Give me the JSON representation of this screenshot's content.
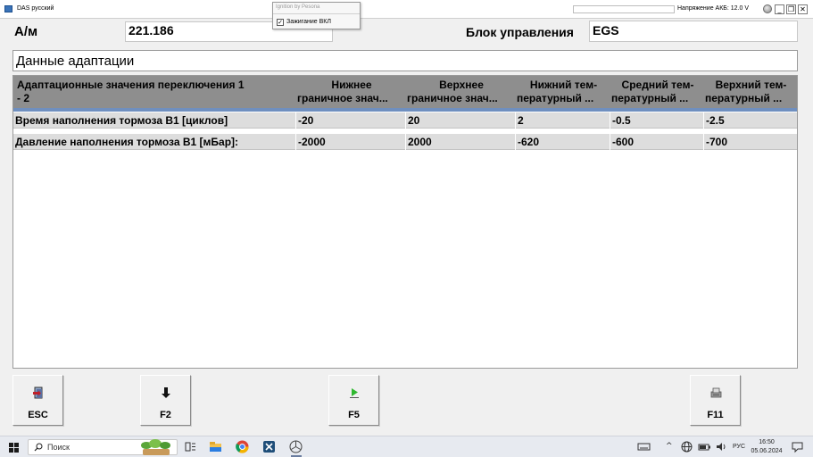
{
  "window": {
    "title": "DAS русский",
    "voltage_label": "Напряжение АКБ: 12.0 V",
    "buttons": {
      "minimize": "_",
      "restore": "❐",
      "close": "✕"
    }
  },
  "popup": {
    "title": "Ignition by Pesona",
    "checkbox_label": "Зажигание ВКЛ",
    "checked": true
  },
  "header": {
    "am_label": "А/м",
    "am_value": "221.186",
    "ecu_label": "Блок управления",
    "ecu_value": "EGS"
  },
  "section_title": "Данные адаптации",
  "table": {
    "columns": [
      {
        "line1": "Адаптационные значения переключения 1",
        "line2": "- 2"
      },
      {
        "line1": "Нижнее",
        "line2": "граничное знач..."
      },
      {
        "line1": "Верхнее",
        "line2": "граничное знач..."
      },
      {
        "line1": "Нижний тем-",
        "line2": "пературный ..."
      },
      {
        "line1": "Средний тем-",
        "line2": "пературный ..."
      },
      {
        "line1": "Верхний тем-",
        "line2": "пературный ..."
      }
    ],
    "rows": [
      [
        "Время наполнения тормоза B1 [циклов]",
        "-20",
        "20",
        "2",
        "-0.5",
        "-2.5"
      ],
      [
        "Давление наполнения тормоза B1 [мБар]:",
        "-2000",
        "2000",
        "-620",
        "-600",
        "-700"
      ]
    ]
  },
  "function_keys": {
    "esc": "ESC",
    "f2": "F2",
    "f5": "F5",
    "f11": "F11"
  },
  "taskbar": {
    "search_placeholder": "Поиск",
    "language": "РУС",
    "time": "16:50",
    "date": "05.06.2024"
  },
  "colors": {
    "header_bg": "#8e8e8e",
    "header_bar": "#6f8fbf",
    "row_bg": "#dddddd",
    "f5_arrow": "#2fb82f"
  }
}
